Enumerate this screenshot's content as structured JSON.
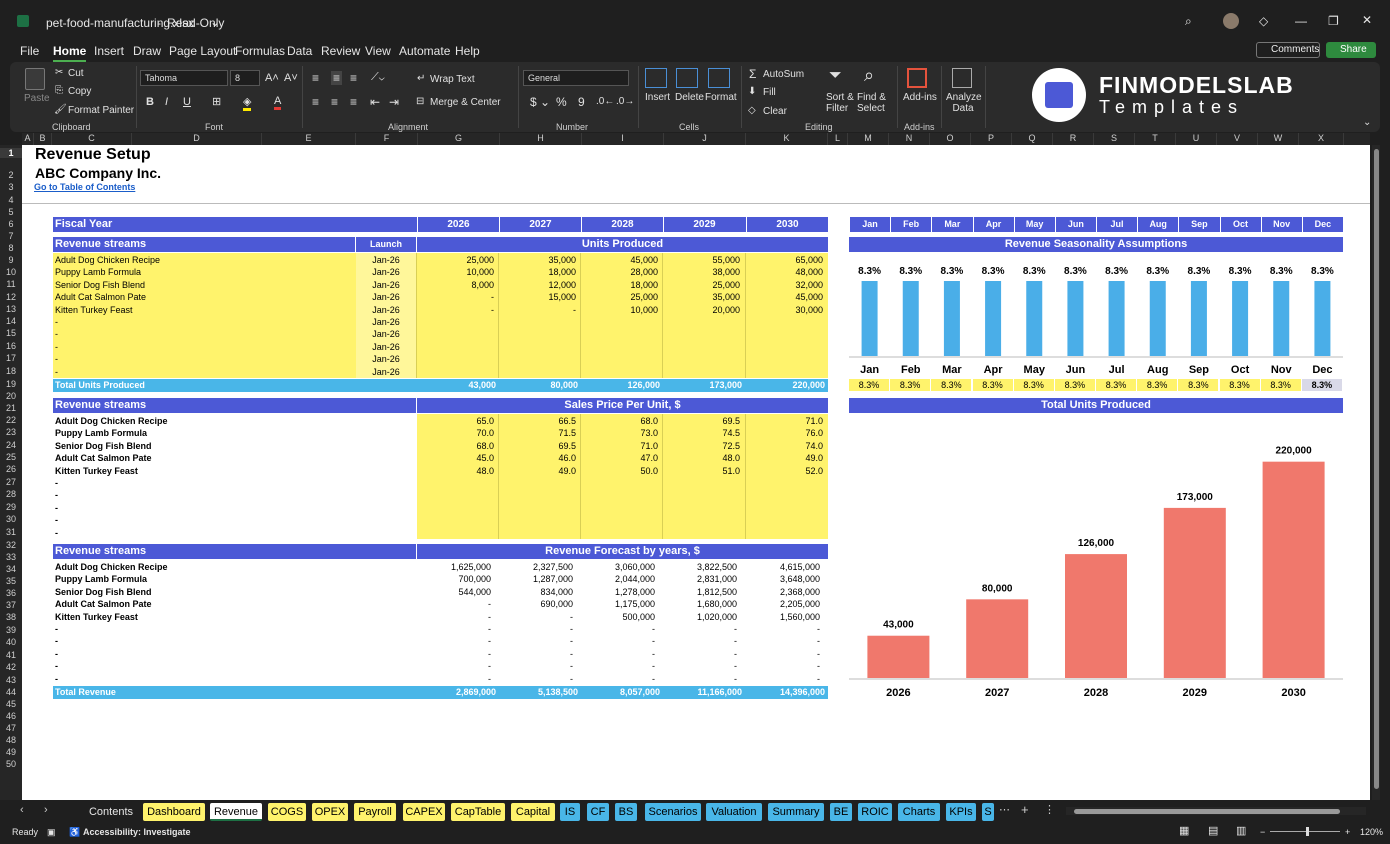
{
  "titlebar": {
    "filename": "pet-food-manufacturing.xlsx",
    "mode": "Read-Only"
  },
  "menu": {
    "items": [
      "File",
      "Home",
      "Insert",
      "Draw",
      "Page Layout",
      "Formulas",
      "Data",
      "Review",
      "View",
      "Automate",
      "Help"
    ],
    "comments": "Comments",
    "share": "Share"
  },
  "ribbon": {
    "paste": "Paste",
    "cut": "Cut",
    "copy": "Copy",
    "format_painter": "Format Painter",
    "clipboard": "Clipboard",
    "font_name": "Tahoma",
    "font_size": "8",
    "font": "Font",
    "wrap_text": "Wrap Text",
    "merge_center": "Merge & Center",
    "alignment": "Alignment",
    "number_format": "General",
    "number": "Number",
    "insert": "Insert",
    "delete": "Delete",
    "format": "Format",
    "cells": "Cells",
    "autosum": "AutoSum",
    "fill": "Fill",
    "clear": "Clear",
    "sort_filter": "Sort & Filter",
    "find_select": "Find & Select",
    "editing": "Editing",
    "addins": "Add-ins",
    "addins_group": "Add-ins",
    "analyze": "Analyze Data",
    "brand_line1": "FINMODELSLAB",
    "brand_line2": "Templates"
  },
  "columns": [
    "A",
    "B",
    "C",
    "D",
    "E",
    "F",
    "G",
    "H",
    "I",
    "J",
    "K",
    "L",
    "M",
    "N",
    "O",
    "P",
    "Q",
    "R",
    "S",
    "T",
    "U",
    "V",
    "W",
    "X"
  ],
  "rows": [
    "1",
    "2",
    "3",
    "4",
    "5",
    "6",
    "7",
    "8",
    "9",
    "10",
    "11",
    "12",
    "13",
    "14",
    "15",
    "16",
    "17",
    "18",
    "19",
    "20",
    "21",
    "22",
    "23",
    "24",
    "25",
    "26",
    "27",
    "28",
    "29",
    "30",
    "31",
    "32",
    "33",
    "34",
    "35",
    "36",
    "37",
    "38",
    "39",
    "40",
    "41",
    "42",
    "43",
    "44",
    "45",
    "46",
    "47",
    "48",
    "49",
    "50"
  ],
  "sheet": {
    "title": "Revenue Setup",
    "company": "ABC Company Inc.",
    "toc_link": "Go to Table of Contents",
    "fiscal_year_label": "Fiscal Year",
    "years": [
      "2026",
      "2027",
      "2028",
      "2029",
      "2030"
    ],
    "months": [
      "Jan",
      "Feb",
      "Mar",
      "Apr",
      "May",
      "Jun",
      "Jul",
      "Aug",
      "Sep",
      "Oct",
      "Nov",
      "Dec"
    ],
    "units": {
      "stream_label": "Revenue streams",
      "launch_label": "Launch",
      "title": "Units Produced",
      "rows": [
        {
          "name": "Adult Dog Chicken Recipe",
          "launch": "Jan-26",
          "v": [
            "25,000",
            "35,000",
            "45,000",
            "55,000",
            "65,000"
          ]
        },
        {
          "name": "Puppy Lamb Formula",
          "launch": "Jan-26",
          "v": [
            "10,000",
            "18,000",
            "28,000",
            "38,000",
            "48,000"
          ]
        },
        {
          "name": "Senior Dog Fish Blend",
          "launch": "Jan-26",
          "v": [
            "8,000",
            "12,000",
            "18,000",
            "25,000",
            "32,000"
          ]
        },
        {
          "name": "Adult Cat Salmon Pate",
          "launch": "Jan-26",
          "v": [
            "-",
            "15,000",
            "25,000",
            "35,000",
            "45,000"
          ]
        },
        {
          "name": "Kitten Turkey Feast",
          "launch": "Jan-26",
          "v": [
            "-",
            "-",
            "10,000",
            "20,000",
            "30,000"
          ]
        },
        {
          "name": "-",
          "launch": "Jan-26",
          "v": [
            "",
            "",
            "",
            "",
            ""
          ]
        },
        {
          "name": "-",
          "launch": "Jan-26",
          "v": [
            "",
            "",
            "",
            "",
            ""
          ]
        },
        {
          "name": "-",
          "launch": "Jan-26",
          "v": [
            "",
            "",
            "",
            "",
            ""
          ]
        },
        {
          "name": "-",
          "launch": "Jan-26",
          "v": [
            "",
            "",
            "",
            "",
            ""
          ]
        },
        {
          "name": "-",
          "launch": "Jan-26",
          "v": [
            "",
            "",
            "",
            "",
            ""
          ]
        }
      ],
      "total_label": "Total Units Produced",
      "totals": [
        "43,000",
        "80,000",
        "126,000",
        "173,000",
        "220,000"
      ]
    },
    "prices": {
      "stream_label": "Revenue streams",
      "title": "Sales Price Per Unit, $",
      "rows": [
        {
          "name": "Adult Dog Chicken Recipe",
          "v": [
            "65.0",
            "66.5",
            "68.0",
            "69.5",
            "71.0"
          ]
        },
        {
          "name": "Puppy Lamb Formula",
          "v": [
            "70.0",
            "71.5",
            "73.0",
            "74.5",
            "76.0"
          ]
        },
        {
          "name": "Senior Dog Fish Blend",
          "v": [
            "68.0",
            "69.5",
            "71.0",
            "72.5",
            "74.0"
          ]
        },
        {
          "name": "Adult Cat Salmon Pate",
          "v": [
            "45.0",
            "46.0",
            "47.0",
            "48.0",
            "49.0"
          ]
        },
        {
          "name": "Kitten Turkey Feast",
          "v": [
            "48.0",
            "49.0",
            "50.0",
            "51.0",
            "52.0"
          ]
        },
        {
          "name": "-",
          "v": [
            "",
            "",
            "",
            "",
            ""
          ]
        },
        {
          "name": "-",
          "v": [
            "",
            "",
            "",
            "",
            ""
          ]
        },
        {
          "name": "-",
          "v": [
            "",
            "",
            "",
            "",
            ""
          ]
        },
        {
          "name": "-",
          "v": [
            "",
            "",
            "",
            "",
            ""
          ]
        },
        {
          "name": "-",
          "v": [
            "",
            "",
            "",
            "",
            ""
          ]
        }
      ]
    },
    "revenue": {
      "stream_label": "Revenue streams",
      "title": "Revenue Forecast by years, $",
      "rows": [
        {
          "name": "Adult Dog Chicken Recipe",
          "v": [
            "1,625,000",
            "2,327,500",
            "3,060,000",
            "3,822,500",
            "4,615,000"
          ]
        },
        {
          "name": "Puppy Lamb Formula",
          "v": [
            "700,000",
            "1,287,000",
            "2,044,000",
            "2,831,000",
            "3,648,000"
          ]
        },
        {
          "name": "Senior Dog Fish Blend",
          "v": [
            "544,000",
            "834,000",
            "1,278,000",
            "1,812,500",
            "2,368,000"
          ]
        },
        {
          "name": "Adult Cat Salmon Pate",
          "v": [
            "-",
            "690,000",
            "1,175,000",
            "1,680,000",
            "2,205,000"
          ]
        },
        {
          "name": "Kitten Turkey Feast",
          "v": [
            "-",
            "-",
            "500,000",
            "1,020,000",
            "1,560,000"
          ]
        },
        {
          "name": "-",
          "v": [
            "-",
            "-",
            "-",
            "-",
            "-"
          ]
        },
        {
          "name": "-",
          "v": [
            "-",
            "-",
            "-",
            "-",
            "-"
          ]
        },
        {
          "name": "-",
          "v": [
            "-",
            "-",
            "-",
            "-",
            "-"
          ]
        },
        {
          "name": "-",
          "v": [
            "-",
            "-",
            "-",
            "-",
            "-"
          ]
        },
        {
          "name": "-",
          "v": [
            "-",
            "-",
            "-",
            "-",
            "-"
          ]
        }
      ],
      "total_label": "Total Revenue",
      "totals": [
        "2,869,000",
        "5,138,500",
        "8,057,000",
        "11,166,000",
        "14,396,000"
      ]
    },
    "seasonality_title": "Revenue Seasonality Assumptions",
    "seasonality_values": [
      "8.3%",
      "8.3%",
      "8.3%",
      "8.3%",
      "8.3%",
      "8.3%",
      "8.3%",
      "8.3%",
      "8.3%",
      "8.3%",
      "8.3%",
      "8.3%"
    ],
    "total_units_chart_title": "Total Units Produced"
  },
  "chart_data": [
    {
      "type": "bar",
      "title": "",
      "categories": [
        "Jan",
        "Feb",
        "Mar",
        "Apr",
        "May",
        "Jun",
        "Jul",
        "Aug",
        "Sep",
        "Oct",
        "Nov",
        "Dec"
      ],
      "values": [
        8.3,
        8.3,
        8.3,
        8.3,
        8.3,
        8.3,
        8.3,
        8.3,
        8.3,
        8.3,
        8.3,
        8.3
      ],
      "data_labels": [
        "8.3%",
        "8.3%",
        "8.3%",
        "8.3%",
        "8.3%",
        "8.3%",
        "8.3%",
        "8.3%",
        "8.3%",
        "8.3%",
        "8.3%",
        "8.3%"
      ],
      "color": "#4aaee8",
      "grid": false
    },
    {
      "type": "bar",
      "title": "",
      "categories": [
        "2026",
        "2027",
        "2028",
        "2029",
        "2030"
      ],
      "values": [
        43000,
        80000,
        126000,
        173000,
        220000
      ],
      "data_labels": [
        "43,000",
        "80,000",
        "126,000",
        "173,000",
        "220,000"
      ],
      "color": "#f0786c",
      "ylim": [
        0,
        240000
      ],
      "grid": false
    }
  ],
  "tabs": [
    {
      "label": "Contents",
      "color": "none"
    },
    {
      "label": "Dashboard",
      "color": "#fff36c"
    },
    {
      "label": "Revenue",
      "color": "#ffffff",
      "active": true
    },
    {
      "label": "COGS",
      "color": "#fff36c"
    },
    {
      "label": "OPEX",
      "color": "#fff36c"
    },
    {
      "label": "Payroll",
      "color": "#fff36c"
    },
    {
      "label": "CAPEX",
      "color": "#fff36c"
    },
    {
      "label": "CapTable",
      "color": "#fff36c"
    },
    {
      "label": "Capital",
      "color": "#fff36c"
    },
    {
      "label": "IS",
      "color": "#49b6e8"
    },
    {
      "label": "CF",
      "color": "#49b6e8"
    },
    {
      "label": "BS",
      "color": "#49b6e8"
    },
    {
      "label": "Scenarios",
      "color": "#49b6e8"
    },
    {
      "label": "Valuation",
      "color": "#49b6e8"
    },
    {
      "label": "Summary",
      "color": "#49b6e8"
    },
    {
      "label": "BE",
      "color": "#49b6e8"
    },
    {
      "label": "ROIC",
      "color": "#49b6e8"
    },
    {
      "label": "Charts",
      "color": "#49b6e8"
    },
    {
      "label": "KPIs",
      "color": "#49b6e8"
    },
    {
      "label": "S",
      "color": "#49b6e8"
    }
  ],
  "status": {
    "ready": "Ready",
    "accessibility": "Accessibility: Investigate",
    "zoom": "120%"
  },
  "colors": {
    "header_blue": "#4c59d6",
    "input_yellow": "#fff36c",
    "total_cyan": "#49b6e8",
    "bar_blue": "#4aaee8",
    "bar_red": "#f0786c"
  }
}
